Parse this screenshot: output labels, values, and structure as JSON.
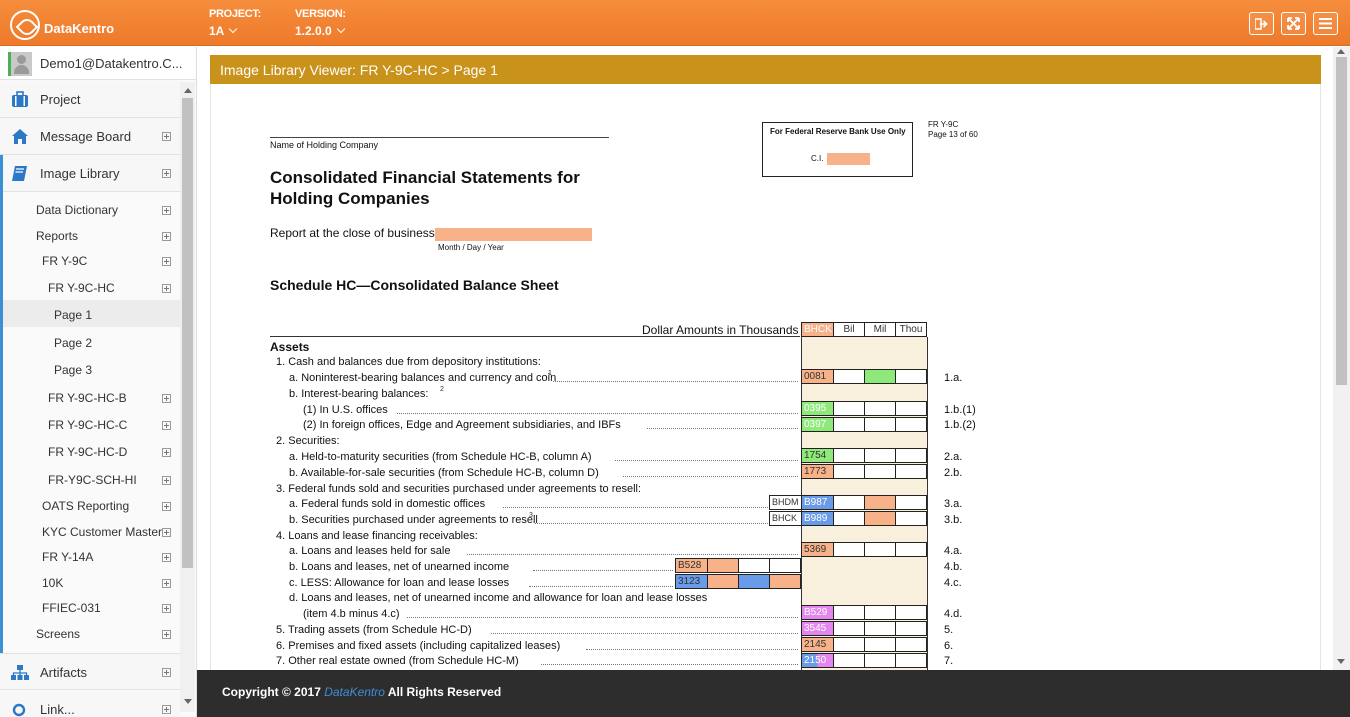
{
  "topbar": {
    "logo_text": "DataKentro",
    "project_label": "PROJECT:",
    "project_value": "1A",
    "version_label": "VERSION:",
    "version_value": "1.2.0.0",
    "icons": [
      "logout-icon",
      "fullscreen-icon",
      "menu-icon"
    ]
  },
  "sidebar": {
    "user": "Demo1@Datakentro.C...",
    "main_items": [
      {
        "label": "Project",
        "icon": "briefcase-icon"
      },
      {
        "label": "Message Board",
        "icon": "home-icon"
      },
      {
        "label": "Image Library",
        "icon": "book-icon"
      },
      {
        "label": "Artifacts",
        "icon": "sitemap-icon"
      }
    ],
    "sub_items": [
      "Data Dictionary",
      "Reports",
      "FR Y-9C",
      "FR Y-9C-HC",
      "Page 1",
      "Page 2",
      "Page 3",
      "FR Y-9C-HC-B",
      "FR Y-9C-HC-C",
      "FR Y-9C-HC-D",
      "FR-Y9C-SCH-HI",
      "OATS Reporting",
      "KYC Customer Master",
      "FR Y-14A",
      "10K",
      "FFIEC-031",
      "Screens"
    ],
    "cut_item": "Link..."
  },
  "main": {
    "title": "Image Library Viewer: FR Y-9C-HC > Page 1"
  },
  "doc": {
    "name_label": "Name of Holding Company",
    "fed_box_title": "For Federal Reserve Bank Use Only",
    "ci_label": "C.I.",
    "form_id": "FR Y-9C",
    "page_of": "Page 13 of 60",
    "title_line1": "Consolidated Financial Statements for",
    "title_line2": "Holding Companies",
    "report_close": "Report at the close of business",
    "date_format": "Month / Day / Year",
    "schedule_title": "Schedule HC—Consolidated Balance Sheet",
    "dollar_amounts": "Dollar Amounts in Thousands",
    "col_prefix": "BHCK",
    "col_bil": "Bil",
    "col_mil": "Mil",
    "col_thou": "Thou",
    "assets": "Assets",
    "rows": [
      {
        "text": "1. Cash and balances due from depository institutions:",
        "code": "",
        "line": ""
      },
      {
        "text": "a. Noninterest-bearing balances and currency and coin",
        "sup": "1",
        "code": "0081",
        "line": "1.a."
      },
      {
        "text": "b. Interest-bearing balances:",
        "sup": "2",
        "code": "",
        "line": ""
      },
      {
        "text": "(1) In U.S. offices",
        "code": "0395",
        "line": "1.b.(1)"
      },
      {
        "text": "(2) In foreign offices, Edge and Agreement subsidiaries, and IBFs",
        "code": "0397",
        "line": "1.b.(2)"
      },
      {
        "text": "2. Securities:",
        "code": "",
        "line": ""
      },
      {
        "text": "a. Held-to-maturity securities (from Schedule HC-B, column A)",
        "code": "1754",
        "line": "2.a."
      },
      {
        "text": "b. Available-for-sale securities (from Schedule HC-B, column D)",
        "code": "1773",
        "line": "2.b."
      },
      {
        "text": "3. Federal funds sold and securities purchased under agreements to resell:",
        "code": "",
        "line": ""
      },
      {
        "text": "a. Federal funds sold in domestic offices",
        "prefix": "BHDM",
        "code": "B987",
        "line": "3.a."
      },
      {
        "text": "b. Securities purchased under agreements to resell",
        "sup": "3",
        "prefix": "BHCK",
        "code": "B989",
        "line": "3.b."
      },
      {
        "text": "4. Loans and lease financing receivables:",
        "code": "",
        "line": ""
      },
      {
        "text": "a. Loans and leases held for sale",
        "code": "5369",
        "line": "4.a."
      },
      {
        "text": "b. Loans and leases, net of unearned income",
        "code": "B528",
        "line": "4.b."
      },
      {
        "text": "c. LESS: Allowance for loan and lease losses",
        "code": "3123",
        "line": "4.c."
      },
      {
        "text": "d. Loans and leases, net of unearned income and allowance for loan and lease losses",
        "code": "",
        "line": ""
      },
      {
        "text": "(item 4.b minus 4.c)",
        "code": "B529",
        "line": "4.d."
      },
      {
        "text": "5. Trading assets (from Schedule HC-D)",
        "code": "3545",
        "line": "5."
      },
      {
        "text": "6. Premises and fixed assets (including capitalized leases)",
        "code": "2145",
        "line": "6."
      },
      {
        "text": "7. Other real estate owned (from Schedule HC-M)",
        "code": "2150",
        "line": "7."
      }
    ]
  },
  "footer": {
    "prefix": "Copyright © 2017",
    "brand": "DataKentro",
    "suffix": "All Rights Reserved"
  }
}
